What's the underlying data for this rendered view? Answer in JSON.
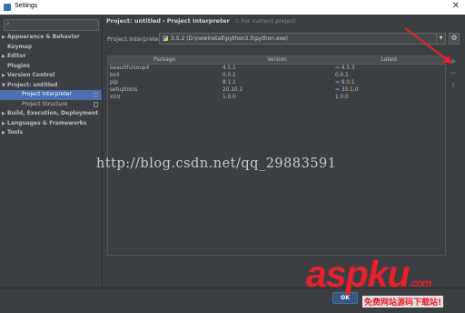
{
  "window": {
    "title": "Settings"
  },
  "sidebar": {
    "items": [
      {
        "label": "Appearance & Behavior",
        "expandable": true
      },
      {
        "label": "Keymap",
        "expandable": false
      },
      {
        "label": "Editor",
        "expandable": true
      },
      {
        "label": "Plugins",
        "expandable": false
      },
      {
        "label": "Version Control",
        "expandable": true
      },
      {
        "label": "Project: untitled",
        "expandable": true,
        "expanded": true
      },
      {
        "label": "Project Interpreter",
        "child": true,
        "selected": true
      },
      {
        "label": "Project Structure",
        "child": true
      },
      {
        "label": "Build, Execution, Deployment",
        "expandable": true
      },
      {
        "label": "Languages & Frameworks",
        "expandable": true
      },
      {
        "label": "Tools",
        "expandable": true
      }
    ]
  },
  "breadcrumb": {
    "project": "Project: untitled",
    "separator": "›",
    "page": "Project Interpreter",
    "note": "For current project"
  },
  "interpreter": {
    "label": "Project Interpreter:",
    "value": "3.5.2 (D:\\newinstall\\python3.5\\python.exe)"
  },
  "packages": {
    "columns": [
      "Package",
      "Version",
      "Latest"
    ],
    "rows": [
      {
        "package": "beautifulsoup4",
        "version": "4.5.1",
        "latest": "4.5.3",
        "upgrade": true
      },
      {
        "package": "bs4",
        "version": "0.0.1",
        "latest": "0.0.1",
        "upgrade": false
      },
      {
        "package": "pip",
        "version": "8.1.1",
        "latest": "9.0.1",
        "upgrade": true
      },
      {
        "package": "setuptools",
        "version": "20.10.1",
        "latest": "33.1.0",
        "upgrade": true
      },
      {
        "package": "xlrd",
        "version": "1.0.0",
        "latest": "1.0.0",
        "upgrade": false
      }
    ]
  },
  "side_buttons": {
    "add": "+",
    "remove": "−",
    "upgrade": "⇧"
  },
  "watermark": "http://blog.csdn.net/qq_29883591",
  "footer": {
    "ok_label": "OK"
  },
  "logo": {
    "main": "aspku",
    "suffix": ".com",
    "sub": "免费网站源码下载站!"
  },
  "colors": {
    "accent": "#4b6eaf",
    "annotation": "#e8202a",
    "upgrade_arrow": "#4a8fd6",
    "add_button": "#5bb85c"
  }
}
